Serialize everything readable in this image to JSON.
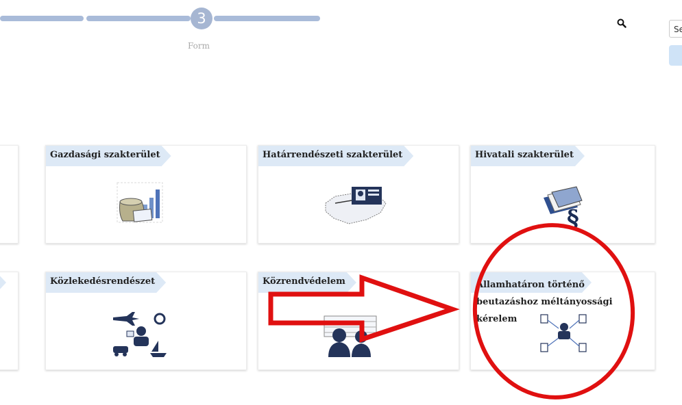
{
  "stepper": {
    "current_step": "3",
    "current_label": "Form"
  },
  "search": {
    "value": "Se"
  },
  "cards": {
    "gazdasagi": "Gazdasági szakterület",
    "hatarrendeszeti": "Határrendészeti szakterület",
    "hivatali": "Hivatali szakterület",
    "kozlekedes": "Közlekedésrendészet",
    "kozrend": "Közrendvédelem",
    "allamhatar": "Államhatáron történő beutazáshoz méltányossági kérelem"
  },
  "colors": {
    "progress": "#a9bbd9",
    "ribbon": "#dde9f6",
    "annotation": "#e01010",
    "icon_navy": "#24345a"
  }
}
